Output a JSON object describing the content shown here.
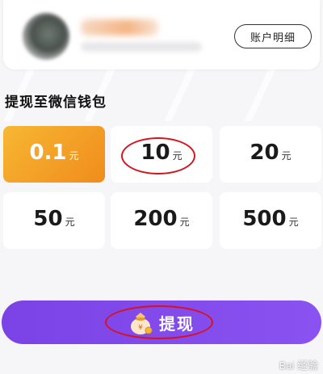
{
  "account": {
    "detail_button_label": "账户明细"
  },
  "section_title": "提现至微信钱包",
  "amounts": [
    {
      "value": "0.1",
      "unit": "元",
      "selected": true
    },
    {
      "value": "10",
      "unit": "元",
      "selected": false
    },
    {
      "value": "20",
      "unit": "元",
      "selected": false
    },
    {
      "value": "50",
      "unit": "元",
      "selected": false
    },
    {
      "value": "200",
      "unit": "元",
      "selected": false
    },
    {
      "value": "500",
      "unit": "元",
      "selected": false
    }
  ],
  "withdraw_button_label": "提现",
  "watermark": "Bai 经验",
  "colors": {
    "selected_gradient_start": "#f7b733",
    "selected_gradient_end": "#f08c1c",
    "button_purple": "#7b43e6",
    "annotation_red": "#d6131d"
  },
  "icons": {
    "withdraw": "money-bag-icon"
  }
}
